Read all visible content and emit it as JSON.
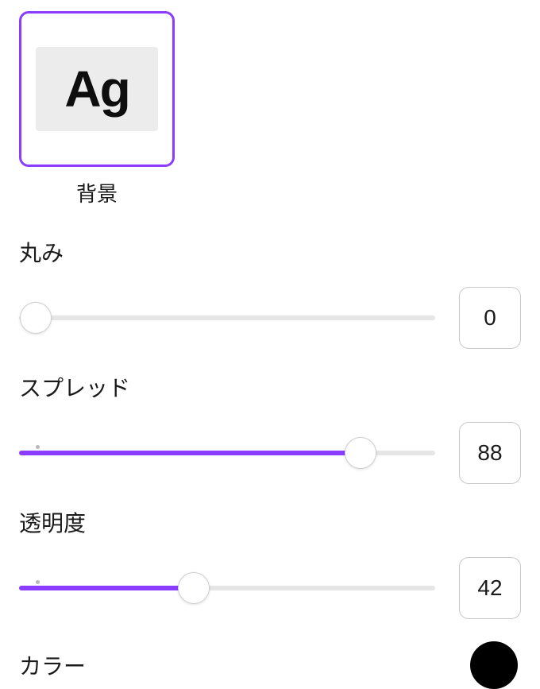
{
  "thumbnail": {
    "sample_text": "Ag",
    "label": "背景"
  },
  "controls": {
    "roundness": {
      "label": "丸み",
      "value": 0,
      "percent": 0,
      "has_tick": false
    },
    "spread": {
      "label": "スプレッド",
      "value": 88,
      "percent": 82,
      "has_tick": true,
      "tick_percent": 4
    },
    "opacity": {
      "label": "透明度",
      "value": 42,
      "percent": 42,
      "has_tick": true,
      "tick_percent": 4
    }
  },
  "color": {
    "label": "カラー",
    "value": "#000000"
  }
}
